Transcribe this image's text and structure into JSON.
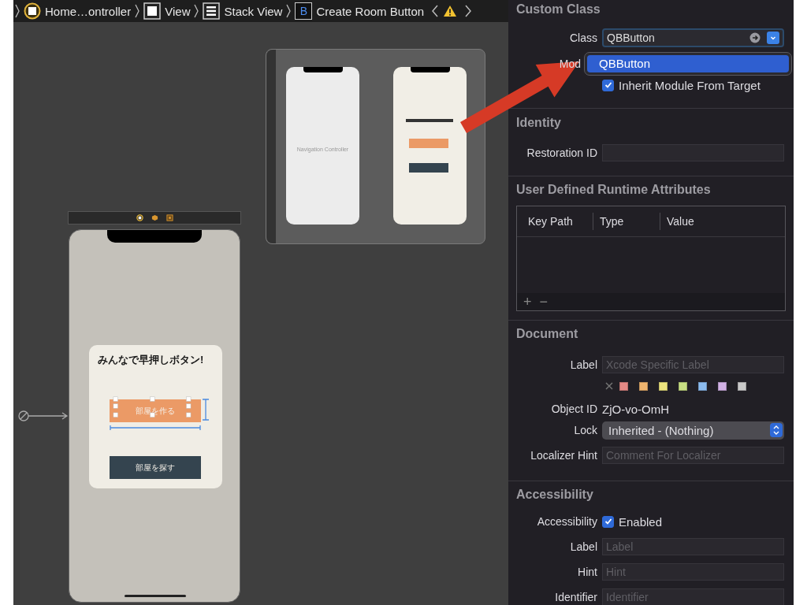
{
  "breadcrumb": {
    "items": [
      {
        "kind": "controller",
        "label": "Home…ontroller"
      },
      {
        "kind": "view",
        "label": "View"
      },
      {
        "kind": "stack",
        "label": "Stack View"
      },
      {
        "kind": "button",
        "glyph": "B",
        "label": "Create Room Button"
      }
    ],
    "warning": true
  },
  "canvas": {
    "scene": {
      "heading": "みんなで早押しボタン!",
      "buttons": [
        {
          "kind": "primary",
          "label": "部屋を作る",
          "selected": true
        },
        {
          "kind": "secondary",
          "label": "部屋を探す",
          "selected": false
        }
      ]
    },
    "overview": {
      "scenes": [
        {
          "kind": "navigation",
          "label": "Navigation Controller"
        },
        {
          "kind": "view"
        }
      ]
    }
  },
  "inspector": {
    "custom_class": {
      "title": "Custom Class",
      "class_label": "Class",
      "class_value": "QBButton",
      "module_label": "Mod",
      "suggestions": [
        {
          "label": "QBButton",
          "selected": true
        }
      ],
      "inherit": {
        "label": "Inherit Module From Target",
        "checked": true
      }
    },
    "identity": {
      "title": "Identity",
      "restoration_label": "Restoration ID"
    },
    "runtime_attributes": {
      "title": "User Defined Runtime Attributes",
      "columns": [
        "Key Path",
        "Type",
        "Value"
      ],
      "add": "+",
      "remove": "−"
    },
    "document": {
      "title": "Document",
      "label_label": "Label",
      "label_placeholder": "Xcode Specific Label",
      "colors": [
        {
          "color": "#e58a86"
        },
        {
          "color": "#efb46e"
        },
        {
          "color": "#ede47e"
        },
        {
          "color": "#c8df83"
        },
        {
          "color": "#8cbcf0"
        },
        {
          "color": "#d2b2e6"
        },
        {
          "color": "#c9c9c9"
        }
      ],
      "object_id_label": "Object ID",
      "object_id": "ZjO-vo-OmH",
      "lock_label": "Lock",
      "lock_value": "Inherited - (Nothing)",
      "localizer_label": "Localizer Hint",
      "localizer_placeholder": "Comment For Localizer"
    },
    "accessibility": {
      "title": "Accessibility",
      "accessibility_label": "Accessibility",
      "enabled": {
        "label": "Enabled",
        "checked": true
      },
      "fields": [
        {
          "label": "Label",
          "placeholder": "Label"
        },
        {
          "label": "Hint",
          "placeholder": "Hint"
        },
        {
          "label": "Identifier",
          "placeholder": "Identifier"
        }
      ]
    }
  }
}
